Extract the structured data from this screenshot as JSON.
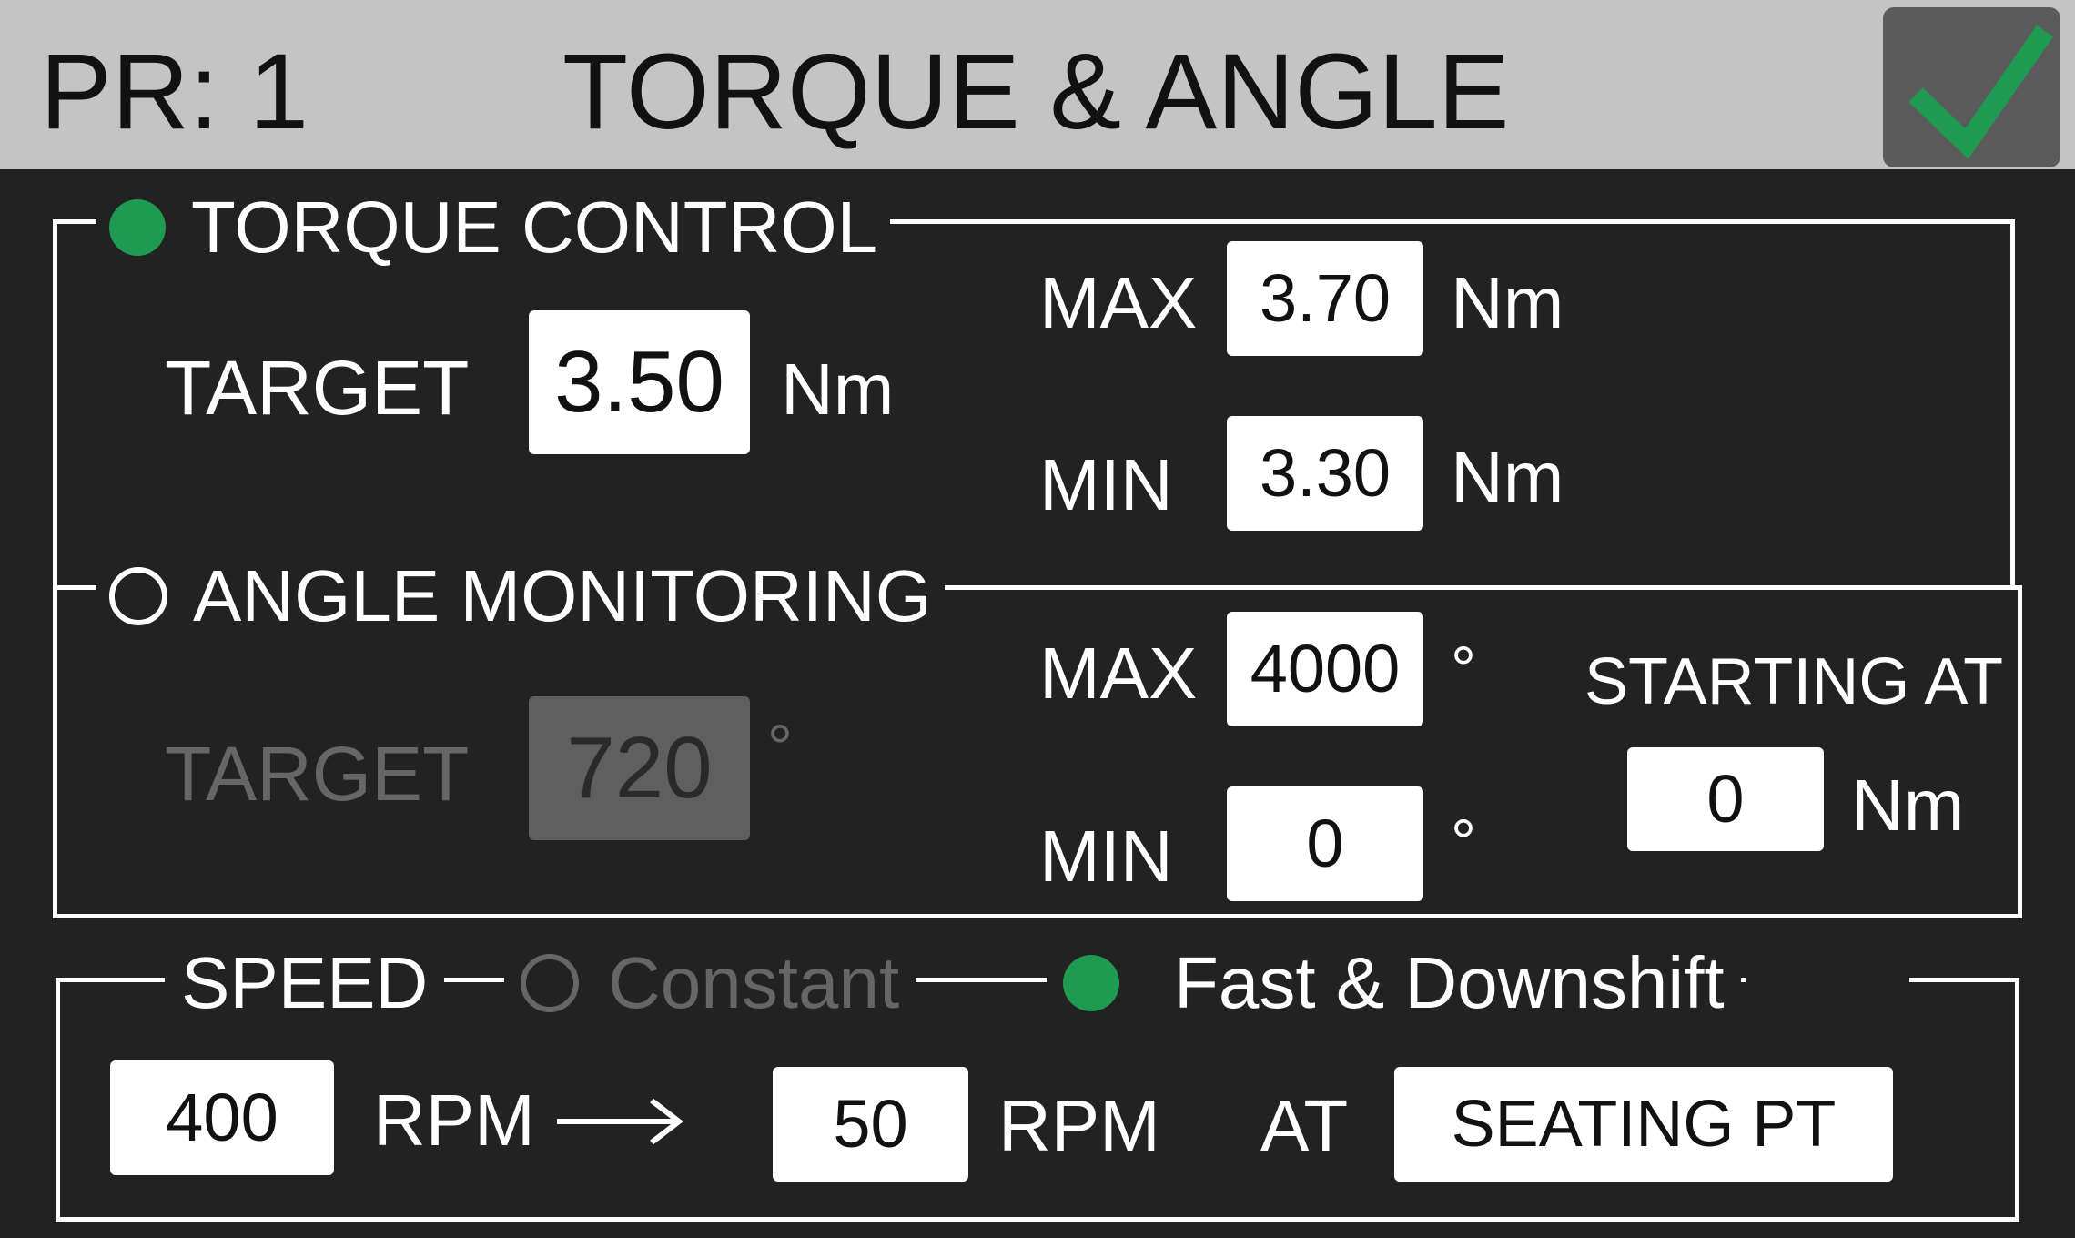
{
  "header": {
    "program": "PR: 1",
    "title": "TORQUE & ANGLE",
    "confirm_icon": "checkmark-icon",
    "confirm_color": "#1f9a52"
  },
  "torque_control": {
    "legend": "TORQUE CONTROL",
    "selected": true,
    "target_label": "TARGET",
    "target_value": "3.50",
    "target_unit": "Nm",
    "max_label": "MAX",
    "max_value": "3.70",
    "max_unit": "Nm",
    "min_label": "MIN",
    "min_value": "3.30",
    "min_unit": "Nm"
  },
  "angle_monitoring": {
    "legend": "ANGLE MONITORING",
    "selected": false,
    "target_label": "TARGET",
    "target_value": "720",
    "target_unit": "°",
    "max_label": "MAX",
    "max_value": "4000",
    "max_unit": "°",
    "min_label": "MIN",
    "min_value": "0",
    "min_unit": "°",
    "starting_label": "STARTING AT",
    "starting_value": "0",
    "starting_unit": "Nm"
  },
  "speed": {
    "legend": "SPEED",
    "option_constant": "Constant",
    "option_fast": "Fast & Downshift",
    "selected_option": "Fast & Downshift",
    "initial_rpm": "400",
    "initial_unit": "RPM",
    "arrow_icon": "arrow-right-icon",
    "final_rpm": "50",
    "final_unit": "RPM",
    "at_label": "AT",
    "at_value": "SEATING PT"
  },
  "colors": {
    "background": "#222222",
    "header": "#c4c4c4",
    "accent_green": "#1f9a52",
    "disabled": "#666666"
  }
}
